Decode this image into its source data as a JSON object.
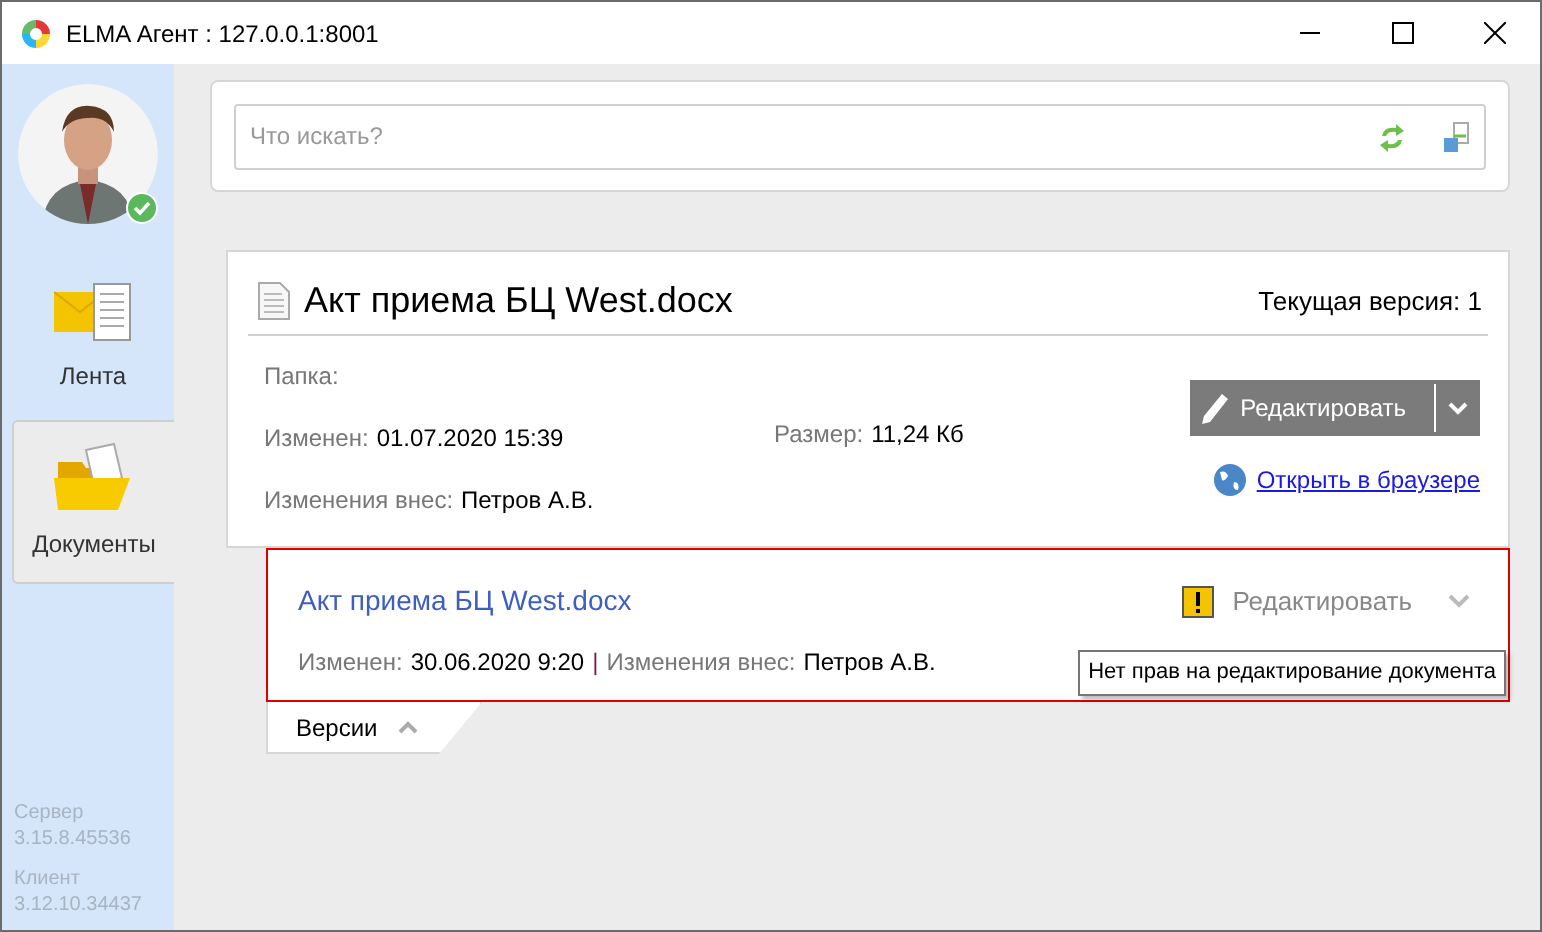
{
  "window": {
    "title": "ELMA Агент : 127.0.0.1:8001"
  },
  "sidebar": {
    "status_online": true,
    "items": [
      {
        "label": "Лента",
        "kind": "feed",
        "selected": false
      },
      {
        "label": "Документы",
        "kind": "documents",
        "selected": true
      }
    ],
    "versions": [
      {
        "label": "Сервер",
        "value": "3.15.8.45536"
      },
      {
        "label": "Клиент",
        "value": "3.12.10.34437"
      }
    ]
  },
  "search": {
    "placeholder": "Что искать?"
  },
  "document": {
    "title": "Акт приема БЦ West.docx",
    "current_version": "Текущая версия: 1",
    "folder_label": "Папка:",
    "modified_label": "Изменен:",
    "modified": "01.07.2020 15:39",
    "size_label": "Размер:",
    "size": "11,24 Кб",
    "author_label": "Изменения внес:",
    "author": "Петров А.В.",
    "edit_button": "Редактировать",
    "open_link": "Открыть в браузере"
  },
  "version": {
    "title": "Акт приема БЦ West.docx",
    "modified_label": "Изменен:",
    "modified": "30.06.2020 9:20",
    "separator": "|",
    "author_label": "Изменения внес:",
    "author": "Петров А.В.",
    "edit_button": "Редактировать",
    "disabled": true,
    "selected": true
  },
  "tooltip": "Нет прав на редактирование документа",
  "versions_tab": {
    "label": "Версии",
    "expanded": true
  }
}
